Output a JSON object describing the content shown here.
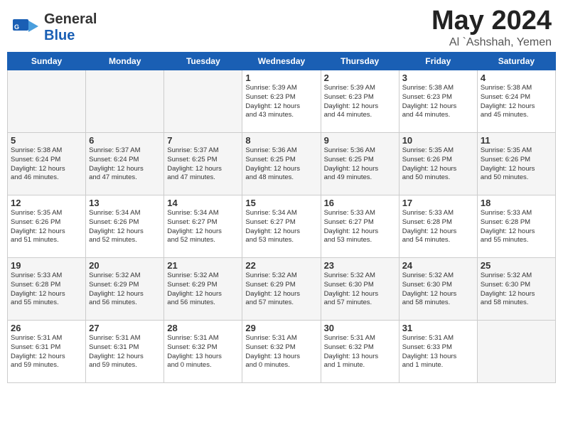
{
  "header": {
    "logo_general": "General",
    "logo_blue": "Blue",
    "month_year": "May 2024",
    "location": "Al `Ashshah, Yemen"
  },
  "days": [
    "Sunday",
    "Monday",
    "Tuesday",
    "Wednesday",
    "Thursday",
    "Friday",
    "Saturday"
  ],
  "weeks": [
    [
      {
        "day": "",
        "content": ""
      },
      {
        "day": "",
        "content": ""
      },
      {
        "day": "",
        "content": ""
      },
      {
        "day": "1",
        "content": "Sunrise: 5:39 AM\nSunset: 6:23 PM\nDaylight: 12 hours\nand 43 minutes."
      },
      {
        "day": "2",
        "content": "Sunrise: 5:39 AM\nSunset: 6:23 PM\nDaylight: 12 hours\nand 44 minutes."
      },
      {
        "day": "3",
        "content": "Sunrise: 5:38 AM\nSunset: 6:23 PM\nDaylight: 12 hours\nand 44 minutes."
      },
      {
        "day": "4",
        "content": "Sunrise: 5:38 AM\nSunset: 6:24 PM\nDaylight: 12 hours\nand 45 minutes."
      }
    ],
    [
      {
        "day": "5",
        "content": "Sunrise: 5:38 AM\nSunset: 6:24 PM\nDaylight: 12 hours\nand 46 minutes."
      },
      {
        "day": "6",
        "content": "Sunrise: 5:37 AM\nSunset: 6:24 PM\nDaylight: 12 hours\nand 47 minutes."
      },
      {
        "day": "7",
        "content": "Sunrise: 5:37 AM\nSunset: 6:25 PM\nDaylight: 12 hours\nand 47 minutes."
      },
      {
        "day": "8",
        "content": "Sunrise: 5:36 AM\nSunset: 6:25 PM\nDaylight: 12 hours\nand 48 minutes."
      },
      {
        "day": "9",
        "content": "Sunrise: 5:36 AM\nSunset: 6:25 PM\nDaylight: 12 hours\nand 49 minutes."
      },
      {
        "day": "10",
        "content": "Sunrise: 5:35 AM\nSunset: 6:26 PM\nDaylight: 12 hours\nand 50 minutes."
      },
      {
        "day": "11",
        "content": "Sunrise: 5:35 AM\nSunset: 6:26 PM\nDaylight: 12 hours\nand 50 minutes."
      }
    ],
    [
      {
        "day": "12",
        "content": "Sunrise: 5:35 AM\nSunset: 6:26 PM\nDaylight: 12 hours\nand 51 minutes."
      },
      {
        "day": "13",
        "content": "Sunrise: 5:34 AM\nSunset: 6:26 PM\nDaylight: 12 hours\nand 52 minutes."
      },
      {
        "day": "14",
        "content": "Sunrise: 5:34 AM\nSunset: 6:27 PM\nDaylight: 12 hours\nand 52 minutes."
      },
      {
        "day": "15",
        "content": "Sunrise: 5:34 AM\nSunset: 6:27 PM\nDaylight: 12 hours\nand 53 minutes."
      },
      {
        "day": "16",
        "content": "Sunrise: 5:33 AM\nSunset: 6:27 PM\nDaylight: 12 hours\nand 53 minutes."
      },
      {
        "day": "17",
        "content": "Sunrise: 5:33 AM\nSunset: 6:28 PM\nDaylight: 12 hours\nand 54 minutes."
      },
      {
        "day": "18",
        "content": "Sunrise: 5:33 AM\nSunset: 6:28 PM\nDaylight: 12 hours\nand 55 minutes."
      }
    ],
    [
      {
        "day": "19",
        "content": "Sunrise: 5:33 AM\nSunset: 6:28 PM\nDaylight: 12 hours\nand 55 minutes."
      },
      {
        "day": "20",
        "content": "Sunrise: 5:32 AM\nSunset: 6:29 PM\nDaylight: 12 hours\nand 56 minutes."
      },
      {
        "day": "21",
        "content": "Sunrise: 5:32 AM\nSunset: 6:29 PM\nDaylight: 12 hours\nand 56 minutes."
      },
      {
        "day": "22",
        "content": "Sunrise: 5:32 AM\nSunset: 6:29 PM\nDaylight: 12 hours\nand 57 minutes."
      },
      {
        "day": "23",
        "content": "Sunrise: 5:32 AM\nSunset: 6:30 PM\nDaylight: 12 hours\nand 57 minutes."
      },
      {
        "day": "24",
        "content": "Sunrise: 5:32 AM\nSunset: 6:30 PM\nDaylight: 12 hours\nand 58 minutes."
      },
      {
        "day": "25",
        "content": "Sunrise: 5:32 AM\nSunset: 6:30 PM\nDaylight: 12 hours\nand 58 minutes."
      }
    ],
    [
      {
        "day": "26",
        "content": "Sunrise: 5:31 AM\nSunset: 6:31 PM\nDaylight: 12 hours\nand 59 minutes."
      },
      {
        "day": "27",
        "content": "Sunrise: 5:31 AM\nSunset: 6:31 PM\nDaylight: 12 hours\nand 59 minutes."
      },
      {
        "day": "28",
        "content": "Sunrise: 5:31 AM\nSunset: 6:32 PM\nDaylight: 13 hours\nand 0 minutes."
      },
      {
        "day": "29",
        "content": "Sunrise: 5:31 AM\nSunset: 6:32 PM\nDaylight: 13 hours\nand 0 minutes."
      },
      {
        "day": "30",
        "content": "Sunrise: 5:31 AM\nSunset: 6:32 PM\nDaylight: 13 hours\nand 1 minute."
      },
      {
        "day": "31",
        "content": "Sunrise: 5:31 AM\nSunset: 6:33 PM\nDaylight: 13 hours\nand 1 minute."
      },
      {
        "day": "",
        "content": ""
      }
    ]
  ]
}
